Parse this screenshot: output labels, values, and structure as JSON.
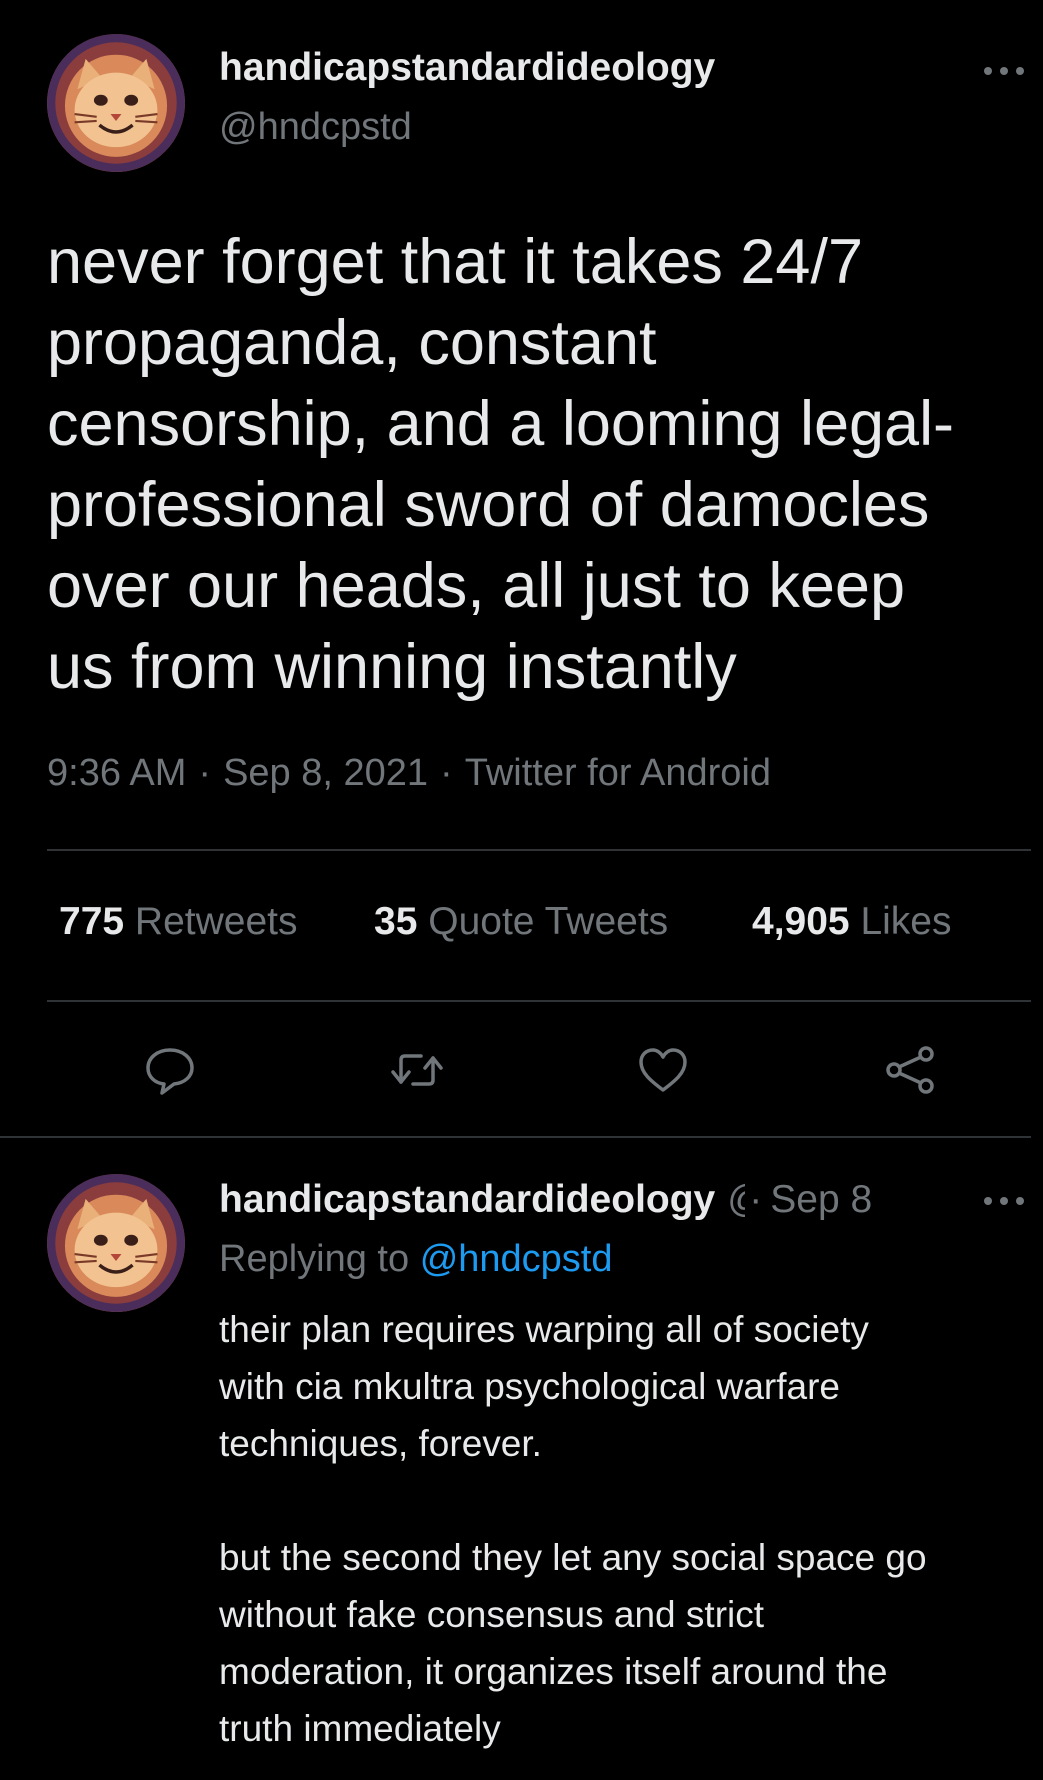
{
  "colors": {
    "background": "#000000",
    "text_primary": "#e7e9ea",
    "text_secondary": "#71767b",
    "divider": "#2f3336",
    "link": "#1d9bf0"
  },
  "main_tweet": {
    "author": {
      "display_name": "handicapstandardideology",
      "handle": "@hndcpstd",
      "avatar_icon": "cat-avatar-icon"
    },
    "text": "never forget that it takes 24/7\npropaganda, constant\ncensorship, and a looming legal-\nprofessional sword of damocles\nover our heads, all just to keep\nus from winning instantly",
    "time": "9:36 AM",
    "date": "Sep 8, 2021",
    "source": "Twitter for Android",
    "separator": "·",
    "stats": {
      "retweets": {
        "count": "775",
        "label": "Retweets"
      },
      "quote_tweets": {
        "count": "35",
        "label": "Quote Tweets"
      },
      "likes": {
        "count": "4,905",
        "label": "Likes"
      }
    },
    "actions": [
      "reply-icon",
      "retweet-icon",
      "like-icon",
      "share-icon"
    ]
  },
  "reply_tweet": {
    "author": {
      "display_name": "handicapstandardideology",
      "handle_truncated": "@",
      "avatar_icon": "cat-avatar-icon"
    },
    "separator": "·",
    "date": "Sep 8",
    "replying_to_label": "Replying to",
    "replying_to_handle": "@hndcpstd",
    "text": "their plan requires warping all of society\nwith cia mkultra psychological warfare\ntechniques, forever.\n\nbut the second they let any social space go\nwithout fake consensus and strict\nmoderation, it organizes itself around the\ntruth immediately"
  }
}
